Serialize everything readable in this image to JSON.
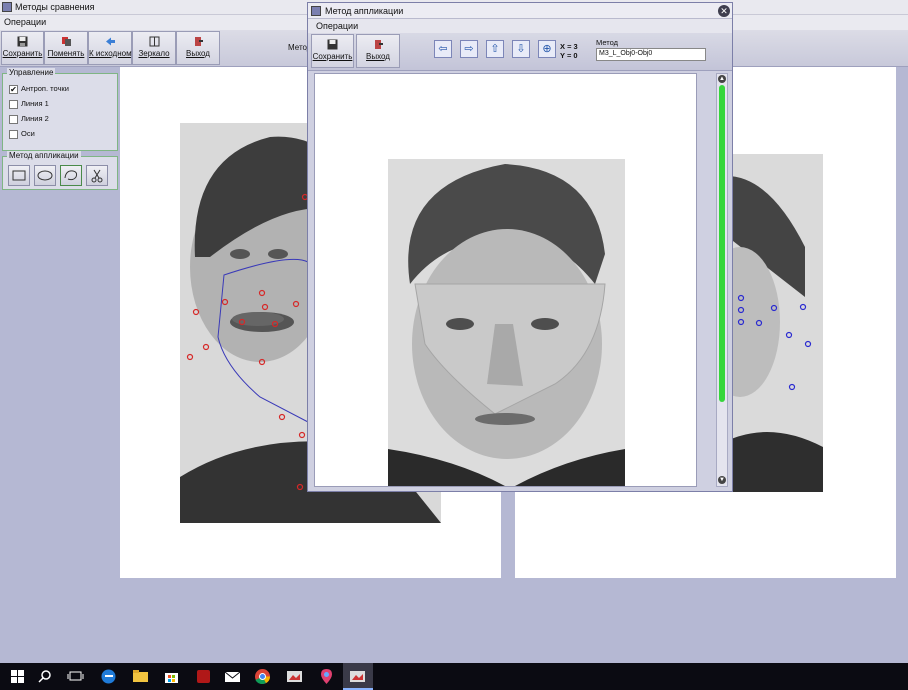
{
  "main_window": {
    "title": "Методы сравнения",
    "menu": "Операции",
    "toolbar": [
      {
        "label": "Сохранить",
        "icon": "save-icon"
      },
      {
        "label": "Поменять",
        "icon": "swap-icon"
      },
      {
        "label": "К исходному",
        "icon": "reset-arrow-icon"
      },
      {
        "label": "Зеркало",
        "icon": "mirror-icon"
      },
      {
        "label": "Выход",
        "icon": "exit-door-icon"
      }
    ],
    "toolbar_hint": "Метод"
  },
  "left_panel": {
    "control_group": {
      "title": "Управление",
      "items": [
        {
          "label": "Антроп. точки",
          "checked": true
        },
        {
          "label": "Линия 1",
          "checked": false
        },
        {
          "label": "Линия 2",
          "checked": false
        },
        {
          "label": "Оси",
          "checked": false
        }
      ]
    },
    "method_group": {
      "title": "Метод аппликации",
      "buttons": [
        "rectangle-select-icon",
        "ellipse-select-icon",
        "freeform-select-icon",
        "scissors-icon"
      ]
    }
  },
  "dialog": {
    "title": "Метод аппликации",
    "close_icon": "close-icon",
    "menu": "Операции",
    "save_label": "Сохранить",
    "exit_label": "Выход",
    "arrows": [
      "arrow-left-icon",
      "arrow-right-icon",
      "arrow-up-icon",
      "arrow-down-icon",
      "center-target-icon"
    ],
    "x_readout": "X = 3",
    "y_readout": "Y = 0",
    "method_label": "Метод",
    "method_value": "M3_L_Obj0-Obj0"
  },
  "taskbar": {
    "icons": [
      "windows-start-icon",
      "search-icon",
      "task-view-icon",
      "edge-icon",
      "file-explorer-icon",
      "store-icon",
      "red-app-icon",
      "mail-icon",
      "chrome-icon",
      "photo-app-icon",
      "maps-app-icon",
      "photo-app-active-icon"
    ]
  },
  "colors": {
    "landmark_red": "#d62828",
    "landmark_blue": "#2a2ad0",
    "outline_blue": "#3a3ab8",
    "progress_green": "#36d63c",
    "background": "#b5b8d3"
  }
}
